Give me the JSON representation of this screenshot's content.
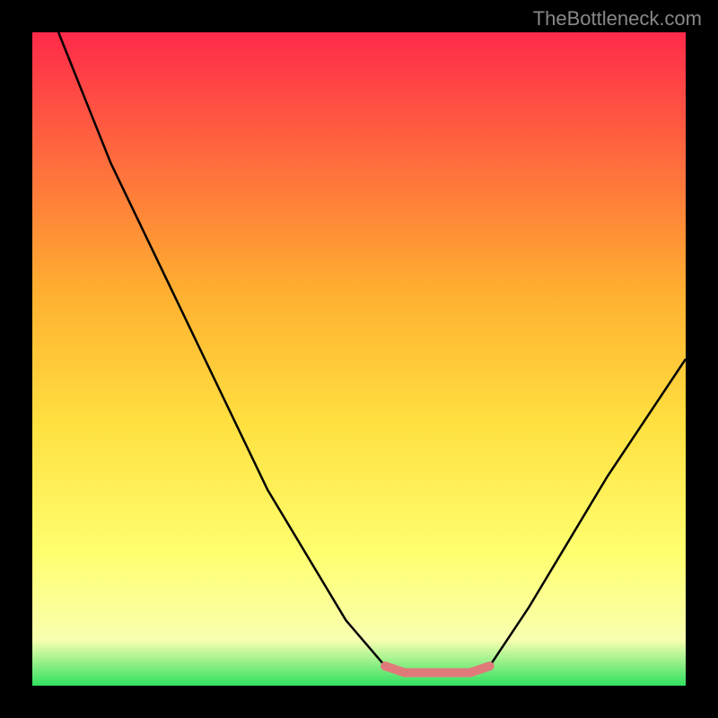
{
  "watermark": "TheBottleneck.com",
  "chart_data": {
    "type": "line",
    "title": "",
    "xlabel": "",
    "ylabel": "",
    "xlim": [
      0,
      100
    ],
    "ylim": [
      0,
      100
    ],
    "gradient_stops": [
      {
        "offset": 0,
        "color": "#ff2a4a"
      },
      {
        "offset": 40,
        "color": "#ffb030"
      },
      {
        "offset": 60,
        "color": "#ffe040"
      },
      {
        "offset": 80,
        "color": "#ffff70"
      },
      {
        "offset": 93,
        "color": "#f8ffb0"
      },
      {
        "offset": 100,
        "color": "#30e060"
      }
    ],
    "series": [
      {
        "name": "bottleneck-curve",
        "color": "#000000",
        "points": [
          {
            "x": 4,
            "y": 100
          },
          {
            "x": 12,
            "y": 80
          },
          {
            "x": 24,
            "y": 55
          },
          {
            "x": 36,
            "y": 30
          },
          {
            "x": 48,
            "y": 10
          },
          {
            "x": 54,
            "y": 3
          },
          {
            "x": 57,
            "y": 2
          },
          {
            "x": 67,
            "y": 2
          },
          {
            "x": 70,
            "y": 3
          },
          {
            "x": 76,
            "y": 12
          },
          {
            "x": 88,
            "y": 32
          },
          {
            "x": 100,
            "y": 50
          }
        ]
      },
      {
        "name": "highlight-range",
        "color": "#e07a7a",
        "points": [
          {
            "x": 54,
            "y": 3
          },
          {
            "x": 57,
            "y": 2
          },
          {
            "x": 62,
            "y": 2
          },
          {
            "x": 67,
            "y": 2
          },
          {
            "x": 70,
            "y": 3
          }
        ]
      }
    ]
  }
}
